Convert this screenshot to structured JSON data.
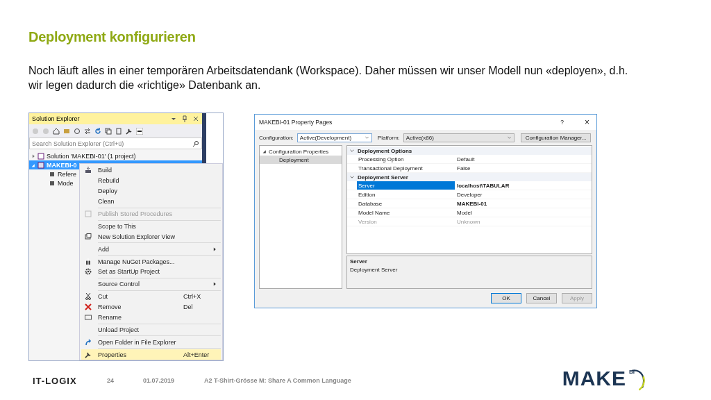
{
  "slide": {
    "title": "Deployment konfigurieren",
    "body": "Noch läuft alles in einer temporären Arbeitsdatendank (Workspace). Daher müssen wir unser Modell nun «deployen», d.h. wir legen dadurch die «richtige» Datenbank an."
  },
  "solution_explorer": {
    "title": "Solution Explorer",
    "search": {
      "placeholder": "Search Solution Explorer (Ctrl+ü)"
    },
    "tree": [
      {
        "label": "Solution 'MAKEBI-01' (1 project)",
        "selected": false,
        "expanded": false
      },
      {
        "label": "MAKEBI-0",
        "selected": true,
        "expanded": true,
        "children": [
          {
            "label": "Refere",
            "selected": false
          },
          {
            "label": "Mode",
            "selected": false
          }
        ]
      }
    ]
  },
  "context_menu": {
    "groups": [
      [
        {
          "label": "Build",
          "disabled": false,
          "selected": false
        },
        {
          "label": "Rebuild",
          "disabled": false,
          "selected": false
        },
        {
          "label": "Deploy",
          "disabled": false,
          "selected": false
        },
        {
          "label": "Clean",
          "disabled": false,
          "selected": false
        }
      ],
      [
        {
          "label": "Publish Stored Procedures",
          "disabled": true,
          "selected": false
        }
      ],
      [
        {
          "label": "Scope to This",
          "disabled": false,
          "selected": false
        },
        {
          "label": "New Solution Explorer View",
          "disabled": false,
          "selected": false
        }
      ],
      [
        {
          "label": "Add",
          "disabled": false,
          "selected": false,
          "submenu": true
        }
      ],
      [
        {
          "label": "Manage NuGet Packages...",
          "disabled": false,
          "selected": false
        },
        {
          "label": "Set as StartUp Project",
          "disabled": false,
          "selected": false
        }
      ],
      [
        {
          "label": "Source Control",
          "disabled": false,
          "selected": false,
          "submenu": true
        }
      ],
      [
        {
          "label": "Cut",
          "shortcut": "Ctrl+X",
          "disabled": false,
          "selected": false
        },
        {
          "label": "Remove",
          "shortcut": "Del",
          "disabled": false,
          "selected": false
        },
        {
          "label": "Rename",
          "disabled": false,
          "selected": false
        }
      ],
      [
        {
          "label": "Unload Project",
          "disabled": false,
          "selected": false
        }
      ],
      [
        {
          "label": "Open Folder in File Explorer",
          "disabled": false,
          "selected": false
        }
      ],
      [
        {
          "label": "Properties",
          "shortcut": "Alt+Enter",
          "disabled": false,
          "selected": true
        }
      ]
    ]
  },
  "dialog": {
    "title": "MAKEBI-01 Property Pages",
    "help": "?",
    "close": "×",
    "configuration": {
      "label": "Configuration:",
      "value": "Active(Development)"
    },
    "platform": {
      "label": "Platform:",
      "value": "Active(x86)"
    },
    "manager_button": "Configuration Manager...",
    "nav": [
      {
        "label": "Configuration Properties",
        "expanded": true,
        "selected": false,
        "children": [
          {
            "label": "Deployment",
            "selected": true
          }
        ]
      }
    ],
    "categories": [
      {
        "name": "Deployment Options",
        "expanded": true,
        "rows": [
          {
            "name": "Processing Option",
            "value": "Default",
            "bold": false,
            "disabled": false,
            "selected": false
          },
          {
            "name": "Transactional Deployment",
            "value": "False",
            "bold": false,
            "disabled": false,
            "selected": false
          }
        ]
      },
      {
        "name": "Deployment Server",
        "expanded": true,
        "rows": [
          {
            "name": "Server",
            "value": "localhost\\TABULAR",
            "bold": true,
            "disabled": false,
            "selected": true
          },
          {
            "name": "Edition",
            "value": "Developer",
            "bold": false,
            "disabled": false,
            "selected": false
          },
          {
            "name": "Database",
            "value": "MAKEBI-01",
            "bold": true,
            "disabled": false,
            "selected": false
          },
          {
            "name": "Model Name",
            "value": "Model",
            "bold": false,
            "disabled": false,
            "selected": false
          },
          {
            "name": "Version",
            "value": "Unknown",
            "bold": false,
            "disabled": true,
            "selected": false
          }
        ]
      }
    ],
    "description": {
      "title": "Server",
      "text": "Deployment Server"
    },
    "buttons": [
      {
        "label": "OK",
        "default": true,
        "disabled": false
      },
      {
        "label": "Cancel",
        "default": false,
        "disabled": false
      },
      {
        "label": "Apply",
        "default": false,
        "disabled": true
      }
    ]
  },
  "footer": {
    "company": "IT-LOGIX",
    "page": "24",
    "date": "01.07.2019",
    "subject": "A2 T-Shirt-Grösse M: Share A Common Language",
    "logo": "MAKE",
    "logo_sup": "BI"
  }
}
